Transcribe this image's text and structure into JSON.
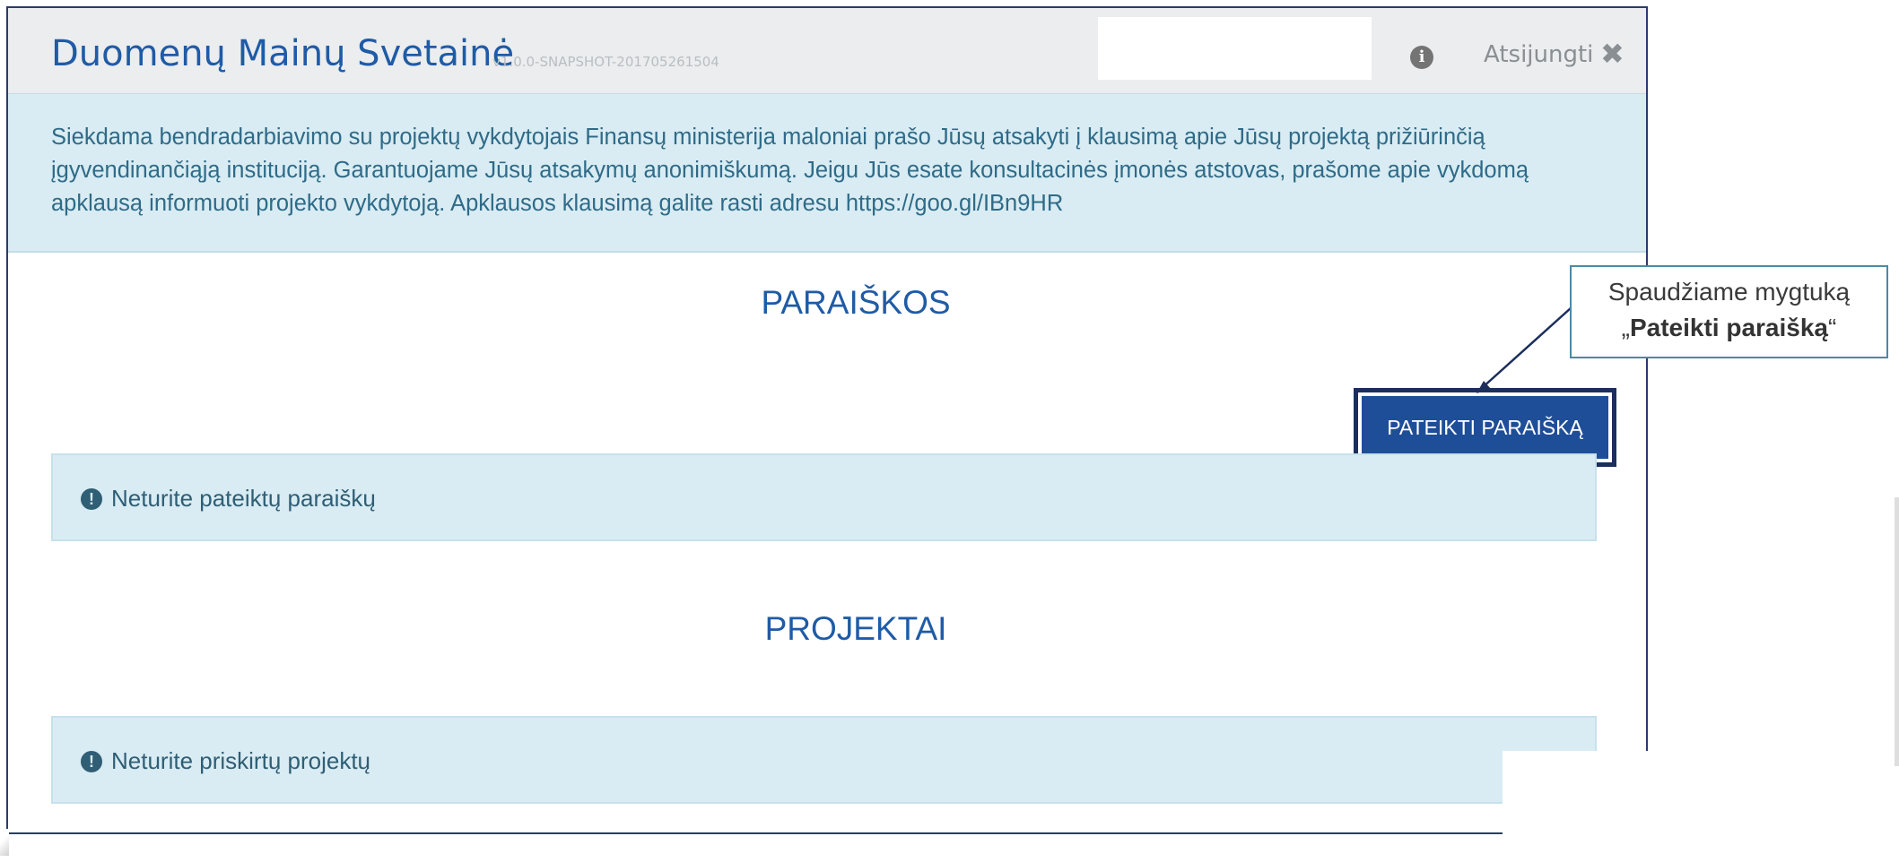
{
  "header": {
    "title": "Duomenų Mainų Svetainė",
    "version": "v1.0.0-SNAPSHOT-201705261504",
    "info_icon": "info-circle-icon",
    "logout_label": "Atsijungti",
    "logout_icon": "close-icon",
    "logout_glyph": "✖"
  },
  "notice": {
    "text": "Siekdama bendradarbiavimo su projektų vykdytojais Finansų ministerija maloniai prašo Jūsų atsakyti į klausimą apie Jūsų projektą prižiūrinčią\nįgyvendinančiąją instituciją. Garantuojame Jūsų atsakymų anonimiškumą. Jeigu Jūs esate konsultacinės įmonės atstovas, prašome apie vykdomą\napklausą informuoti projekto vykdytoją. Apklausos klausimą galite rasti adresu https://goo.gl/IBn9HR"
  },
  "applications": {
    "title": "PARAIŠKOS",
    "submit_label": "PATEIKTI PARAIŠKĄ",
    "empty_text": "Neturite pateiktų paraiškų",
    "empty_icon": "exclamation-circle-icon"
  },
  "projects": {
    "title": "PROJEKTAI",
    "empty_text": "Neturite priskirtų projektų",
    "empty_icon": "exclamation-circle-icon"
  },
  "callout": {
    "line1": "Spaudžiame mygtuką",
    "quote_open": "„",
    "bold": "Pateikti paraišką",
    "quote_close": "“"
  },
  "colors": {
    "brand": "#1f5ba6",
    "button": "#1f4e99",
    "alert_bg": "#d9ecf3",
    "highlight_border": "#1b2e5c"
  }
}
